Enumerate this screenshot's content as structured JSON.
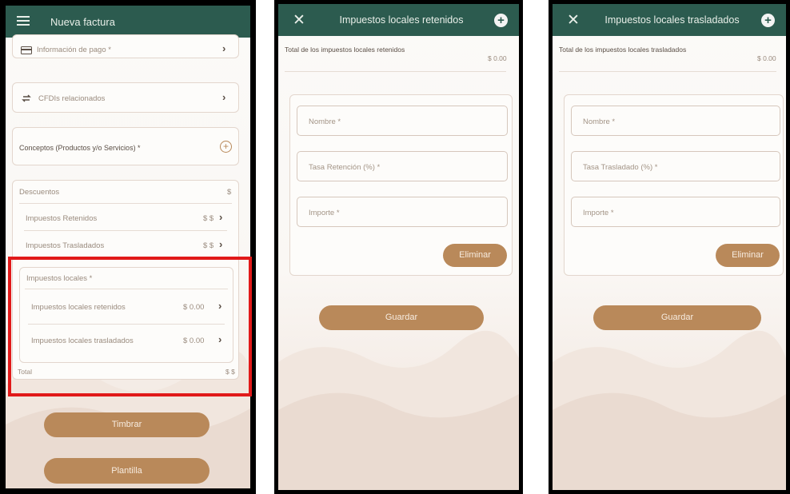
{
  "screen1": {
    "title": "Nueva factura",
    "pago_label": "Información de pago *",
    "cfdis_label": "CFDIs relacionados",
    "conceptos_label": "Conceptos (Productos y/o Servicios) *",
    "descuentos_label": "Descuentos",
    "descuentos_value": "$",
    "retenidos_label": "Impuestos Retenidos",
    "retenidos_value": "$ $",
    "trasladados_label": "Impuestos Trasladados",
    "trasladados_value": "$ $",
    "locales_label": "Impuestos locales *",
    "locales_retenidos_label": "Impuestos locales retenidos",
    "locales_retenidos_value": "$ 0.00",
    "locales_trasladados_label": "Impuestos locales trasladados",
    "locales_trasladados_value": "$ 0.00",
    "total_label": "Total",
    "total_value": "$ $",
    "timbrar_button": "Timbrar",
    "plantilla_button": "Plantilla"
  },
  "screen2": {
    "title": "Impuestos locales retenidos",
    "total_label": "Total de los impuestos locales retenidos",
    "total_value": "$ 0.00",
    "nombre_placeholder": "Nombre *",
    "tasa_placeholder": "Tasa Retención (%) *",
    "importe_placeholder": "Importe *",
    "eliminar_button": "Eliminar",
    "guardar_button": "Guardar"
  },
  "screen3": {
    "title": "Impuestos locales trasladados",
    "total_label": "Total de los impuestos locales trasladados",
    "total_value": "$ 0.00",
    "nombre_placeholder": "Nombre *",
    "tasa_placeholder": "Tasa Trasladado (%) *",
    "importe_placeholder": "Importe *",
    "eliminar_button": "Eliminar",
    "guardar_button": "Guardar"
  },
  "icons": {
    "menu": "hamburger-menu-icon",
    "close": "close-icon",
    "add": "add-circle-icon",
    "chevron": "chevron-right-icon",
    "link": "link-icon",
    "credit_card": "credit-card-icon"
  },
  "colors": {
    "appbar": "#2c5b4f",
    "accent": "#b9895a",
    "highlight": "#e11919"
  }
}
